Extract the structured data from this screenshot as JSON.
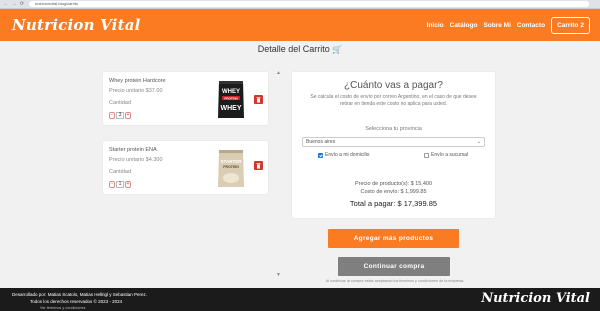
{
  "browser": {
    "url": "nutricionvital.blog/carrito",
    "nav_back": "←",
    "nav_fwd": "→",
    "nav_reload": "⟳"
  },
  "header": {
    "logo": "Nutricion Vital",
    "links": [
      "Inicio",
      "Catálogo",
      "Sobre Mi",
      "Contacto"
    ],
    "cart_label": "Carrito",
    "cart_count": "2",
    "bg_color": "#fa7b22"
  },
  "page": {
    "title": "Detalle del Carrito",
    "title_icon": "🛒"
  },
  "cart_items": [
    {
      "name": "Whey protein Hardcore",
      "price": "Precio unitario $37.00",
      "qty_label": "Cantidad",
      "qty": "3",
      "minus": "-",
      "plus": "+",
      "image": "whey-protein-bag"
    },
    {
      "name": "Starter protein ENA",
      "price": "Precio unitario $4.300",
      "qty_label": "Cantidad",
      "qty": "1",
      "minus": "-",
      "plus": "+",
      "image": "starter-protein-bag"
    }
  ],
  "image_text": {
    "whey_top": "WHEY",
    "whey_mid": "PROTEIN",
    "whey_bottom": "WHEY",
    "starter_top": "STARTER",
    "starter_mid": "PROTEIN"
  },
  "shipping": {
    "question": "¿Cuánto vas a pagar?",
    "description": "Se calcula el costo de envío por correo Argentino, en el caso de que desee retirar en tienda este costo no aplica para usted.",
    "province_label": "Selecciona tu provincia",
    "province_value": "Buenos aires",
    "option_home": "Envío a mi domicilio",
    "option_branch": "Envío a sucursal",
    "home_checked": true,
    "branch_checked": false,
    "products_price": "Precio de producto(s): $ 15,400",
    "shipping_cost": "Costo de envío: $ 1,999.85",
    "total": "Total a pagar: $ 17,399.85"
  },
  "actions": {
    "add_more": "Agregar más productos",
    "continue": "Continuar compra",
    "terms": "Al continuar la compra estás aceptando los términos y condiciones de la empresa."
  },
  "footer": {
    "line1": "Desarrollado por: Matias Scatolo, Matias Hellrigl y Sebastian Perez.",
    "line2": "Todos los derechos reservados © 2023 - 2024",
    "line3": "Ver términos y condiciones",
    "logo": "Nutricion Vital"
  }
}
